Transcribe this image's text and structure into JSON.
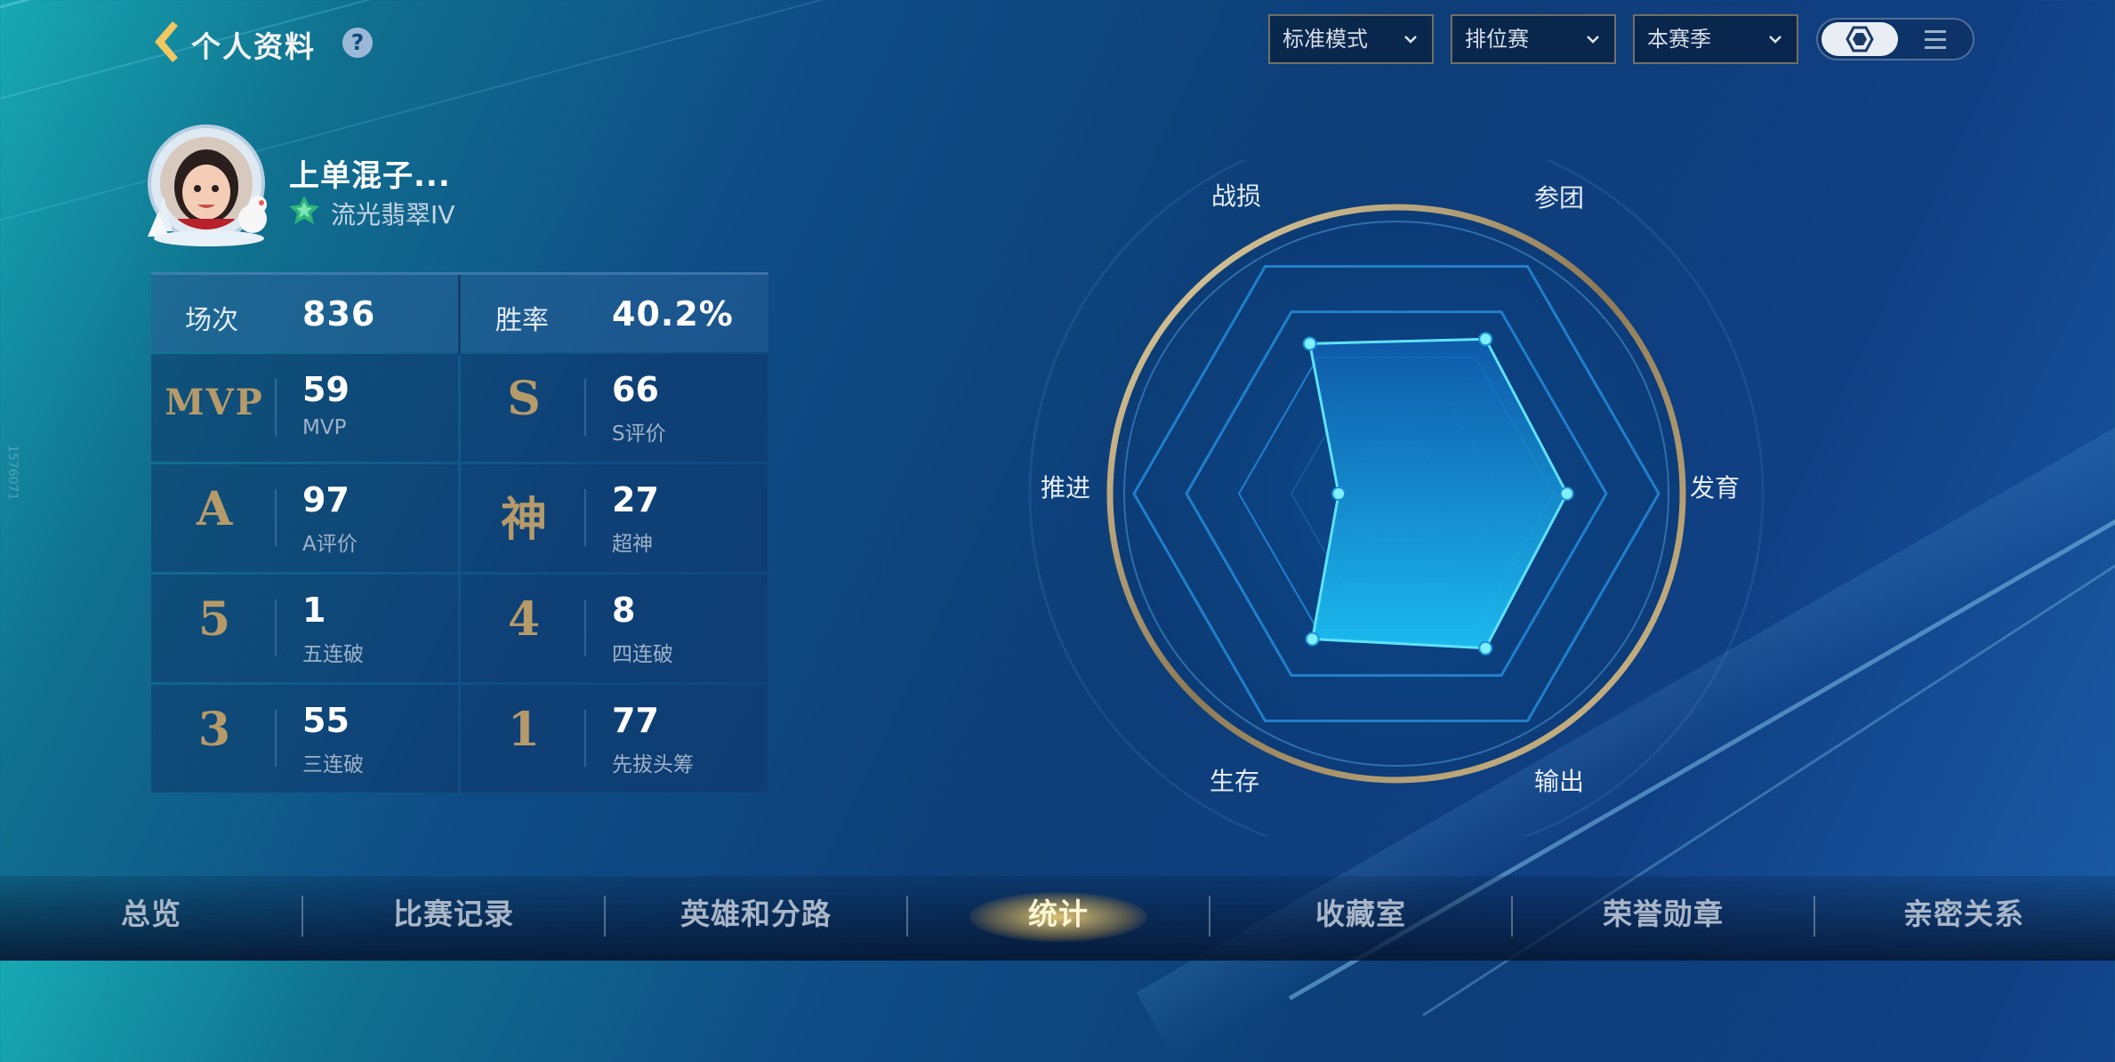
{
  "header": {
    "title": "个人资料",
    "help_label": "?",
    "filters": [
      "标准模式",
      "排位赛",
      "本赛季"
    ]
  },
  "profile": {
    "name": "上单混子...",
    "rank": "流光翡翠IV"
  },
  "stats": {
    "matches_label": "场次",
    "matches_value": "836",
    "winrate_label": "胜率",
    "winrate_value": "40.2%",
    "cells": [
      {
        "glyph": "MVP",
        "value": "59",
        "label": "MVP"
      },
      {
        "glyph": "S",
        "value": "66",
        "label": "S评价"
      },
      {
        "glyph": "A",
        "value": "97",
        "label": "A评价"
      },
      {
        "glyph": "神",
        "value": "27",
        "label": "超神"
      },
      {
        "glyph": "5",
        "value": "1",
        "label": "五连破"
      },
      {
        "glyph": "4",
        "value": "8",
        "label": "四连破"
      },
      {
        "glyph": "3",
        "value": "55",
        "label": "三连破"
      },
      {
        "glyph": "1",
        "value": "77",
        "label": "先拔头筹"
      }
    ]
  },
  "radar": {
    "axes": [
      "战损",
      "参团",
      "发育",
      "输出",
      "生存",
      "推进"
    ],
    "values": [
      0.66,
      0.68,
      0.65,
      0.68,
      0.64,
      0.22
    ]
  },
  "nav": {
    "items": [
      "总览",
      "比赛记录",
      "英雄和分路",
      "统计",
      "收藏室",
      "荣誉勋章",
      "亲密关系"
    ],
    "active_index": 3
  },
  "side_code": "1576071",
  "colors": {
    "accent_gold": "#b69a69",
    "radar_fill": "#1ca8ec",
    "radar_stroke": "#5fe2ff"
  }
}
